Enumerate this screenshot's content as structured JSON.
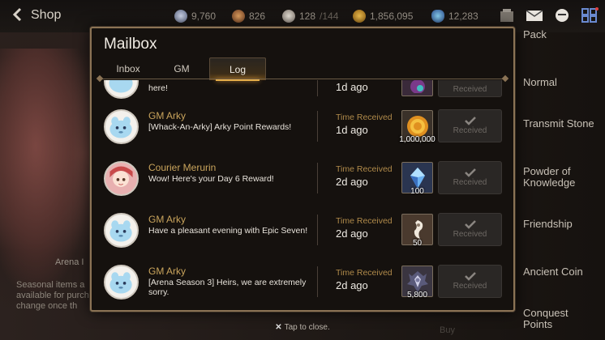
{
  "topbar": {
    "title": "Shop",
    "resources": [
      {
        "name": "skystone",
        "value": "9,760"
      },
      {
        "name": "stigma",
        "value": "826"
      },
      {
        "name": "energy",
        "value": "128",
        "max": "/144"
      },
      {
        "name": "gold",
        "value": "1,856,095"
      },
      {
        "name": "crystal",
        "value": "12,283"
      }
    ]
  },
  "right_menu": {
    "items": [
      "Pack",
      "Normal",
      "Transmit Stone",
      "Powder of Knowledge",
      "Friendship",
      "Ancient Coin",
      "Conquest Points"
    ]
  },
  "left_panel": {
    "arena_label": "Arena I",
    "seasonal_text": "Seasonal items a available for purcha change once th"
  },
  "ghost_buy": "Buy",
  "mailbox": {
    "title": "Mailbox",
    "tabs": [
      "Inbox",
      "GM",
      "Log"
    ],
    "active_tab": "Log",
    "partial_row": {
      "subject": "here!",
      "time_value": "1d ago",
      "status": "Received"
    },
    "rows": [
      {
        "sender": "GM Arky",
        "subject": "[Whack-An-Arky] Arky Point Rewards!",
        "time_label": "Time Received",
        "time_value": "1d ago",
        "reward_icon": "gold-coin-icon",
        "reward_qty": "1,000,000",
        "status": "Received",
        "avatar": "arky"
      },
      {
        "sender": "Courier Merurin",
        "subject": "Wow! Here's your Day 6 Reward!",
        "time_label": "Time Received",
        "time_value": "2d ago",
        "reward_icon": "crystal-icon",
        "reward_qty": "100",
        "status": "Received",
        "avatar": "merurin"
      },
      {
        "sender": "GM Arky",
        "subject": "Have a pleasant evening with Epic Seven!",
        "time_label": "Time Received",
        "time_value": "2d ago",
        "reward_icon": "stigma-icon",
        "reward_qty": "50",
        "status": "Received",
        "avatar": "arky"
      },
      {
        "sender": "GM Arky",
        "subject": "[Arena Season 3] Heirs, we are extremely sorry.",
        "time_label": "Time Received",
        "time_value": "2d ago",
        "reward_icon": "arena-flag-icon",
        "reward_qty": "5,800",
        "status": "Received",
        "avatar": "arky"
      }
    ]
  },
  "footer": {
    "close_hint": "Tap to close."
  },
  "colors": {
    "frame": "#8b7355",
    "accent": "#e8b04a",
    "sender": "#c9a45c",
    "time_label": "#b08a4a"
  }
}
